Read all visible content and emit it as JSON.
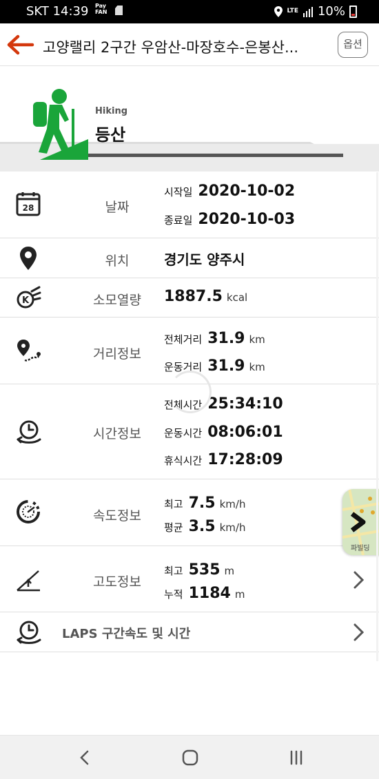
{
  "status_bar": {
    "carrier": "SKT",
    "time": "14:39",
    "pay": "Pay",
    "pay_sub": "FAN",
    "network": "LTE",
    "battery": "10%"
  },
  "header": {
    "title": "고양랠리 2구간 우암산-마장호수-은봉산...",
    "option_label": "옵션",
    "back_icon": "back-arrow-icon",
    "accent": "#d4380d"
  },
  "activity": {
    "subtitle": "Hiking",
    "title": "등산",
    "icon": "hiker-icon",
    "color": "#1aa53a"
  },
  "rows": {
    "date": {
      "label": "날짜",
      "start_key": "시작일",
      "start_value": "2020-10-02",
      "end_key": "종료일",
      "end_value": "2020-10-03",
      "icon_day": "28"
    },
    "location": {
      "label": "위치",
      "value": "경기도 양주시"
    },
    "calories": {
      "label": "소모열량",
      "value": "1887.5",
      "unit": "kcal"
    },
    "distance": {
      "label": "거리정보",
      "total_key": "전체거리",
      "total_value": "31.9",
      "total_unit": "km",
      "move_key": "운동거리",
      "move_value": "31.9",
      "move_unit": "km"
    },
    "time": {
      "label": "시간정보",
      "total_key": "전체시간",
      "total_value": "25:34:10",
      "move_key": "운동시간",
      "move_value": "08:06:01",
      "rest_key": "휴식시간",
      "rest_value": "17:28:09"
    },
    "speed": {
      "label": "속도정보",
      "max_key": "최고",
      "max_value": "7.5",
      "max_unit": "km/h",
      "avg_key": "평균",
      "avg_value": "3.5",
      "avg_unit": "km/h"
    },
    "altitude": {
      "label": "고도정보",
      "max_key": "최고",
      "max_value": "535",
      "max_unit": "m",
      "acc_key": "누적",
      "acc_value": "1184",
      "acc_unit": "m"
    },
    "laps": {
      "label": "LAPS 구간속도 및 시간"
    }
  },
  "map_thumb": {
    "text": "파빌딩"
  }
}
